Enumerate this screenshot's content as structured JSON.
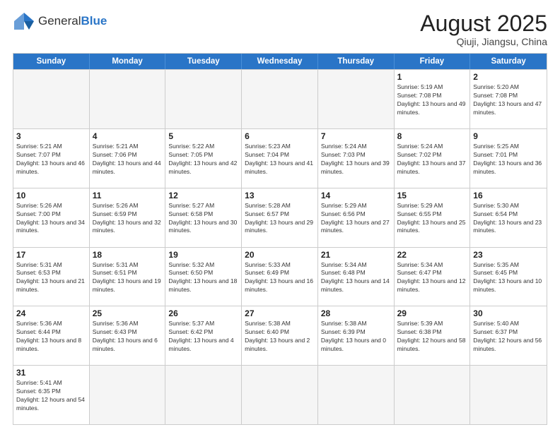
{
  "logo": {
    "text_general": "General",
    "text_blue": "Blue"
  },
  "title": "August 2025",
  "subtitle": "Qiuji, Jiangsu, China",
  "header_days": [
    "Sunday",
    "Monday",
    "Tuesday",
    "Wednesday",
    "Thursday",
    "Friday",
    "Saturday"
  ],
  "weeks": [
    [
      {
        "day": "",
        "empty": true
      },
      {
        "day": "",
        "empty": true
      },
      {
        "day": "",
        "empty": true
      },
      {
        "day": "",
        "empty": true
      },
      {
        "day": "",
        "empty": true
      },
      {
        "day": "1",
        "sunrise": "5:19 AM",
        "sunset": "7:08 PM",
        "daylight": "13 hours and 49 minutes."
      },
      {
        "day": "2",
        "sunrise": "5:20 AM",
        "sunset": "7:08 PM",
        "daylight": "13 hours and 47 minutes."
      }
    ],
    [
      {
        "day": "3",
        "sunrise": "5:21 AM",
        "sunset": "7:07 PM",
        "daylight": "13 hours and 46 minutes."
      },
      {
        "day": "4",
        "sunrise": "5:21 AM",
        "sunset": "7:06 PM",
        "daylight": "13 hours and 44 minutes."
      },
      {
        "day": "5",
        "sunrise": "5:22 AM",
        "sunset": "7:05 PM",
        "daylight": "13 hours and 42 minutes."
      },
      {
        "day": "6",
        "sunrise": "5:23 AM",
        "sunset": "7:04 PM",
        "daylight": "13 hours and 41 minutes."
      },
      {
        "day": "7",
        "sunrise": "5:24 AM",
        "sunset": "7:03 PM",
        "daylight": "13 hours and 39 minutes."
      },
      {
        "day": "8",
        "sunrise": "5:24 AM",
        "sunset": "7:02 PM",
        "daylight": "13 hours and 37 minutes."
      },
      {
        "day": "9",
        "sunrise": "5:25 AM",
        "sunset": "7:01 PM",
        "daylight": "13 hours and 36 minutes."
      }
    ],
    [
      {
        "day": "10",
        "sunrise": "5:26 AM",
        "sunset": "7:00 PM",
        "daylight": "13 hours and 34 minutes."
      },
      {
        "day": "11",
        "sunrise": "5:26 AM",
        "sunset": "6:59 PM",
        "daylight": "13 hours and 32 minutes."
      },
      {
        "day": "12",
        "sunrise": "5:27 AM",
        "sunset": "6:58 PM",
        "daylight": "13 hours and 30 minutes."
      },
      {
        "day": "13",
        "sunrise": "5:28 AM",
        "sunset": "6:57 PM",
        "daylight": "13 hours and 29 minutes."
      },
      {
        "day": "14",
        "sunrise": "5:29 AM",
        "sunset": "6:56 PM",
        "daylight": "13 hours and 27 minutes."
      },
      {
        "day": "15",
        "sunrise": "5:29 AM",
        "sunset": "6:55 PM",
        "daylight": "13 hours and 25 minutes."
      },
      {
        "day": "16",
        "sunrise": "5:30 AM",
        "sunset": "6:54 PM",
        "daylight": "13 hours and 23 minutes."
      }
    ],
    [
      {
        "day": "17",
        "sunrise": "5:31 AM",
        "sunset": "6:53 PM",
        "daylight": "13 hours and 21 minutes."
      },
      {
        "day": "18",
        "sunrise": "5:31 AM",
        "sunset": "6:51 PM",
        "daylight": "13 hours and 19 minutes."
      },
      {
        "day": "19",
        "sunrise": "5:32 AM",
        "sunset": "6:50 PM",
        "daylight": "13 hours and 18 minutes."
      },
      {
        "day": "20",
        "sunrise": "5:33 AM",
        "sunset": "6:49 PM",
        "daylight": "13 hours and 16 minutes."
      },
      {
        "day": "21",
        "sunrise": "5:34 AM",
        "sunset": "6:48 PM",
        "daylight": "13 hours and 14 minutes."
      },
      {
        "day": "22",
        "sunrise": "5:34 AM",
        "sunset": "6:47 PM",
        "daylight": "13 hours and 12 minutes."
      },
      {
        "day": "23",
        "sunrise": "5:35 AM",
        "sunset": "6:45 PM",
        "daylight": "13 hours and 10 minutes."
      }
    ],
    [
      {
        "day": "24",
        "sunrise": "5:36 AM",
        "sunset": "6:44 PM",
        "daylight": "13 hours and 8 minutes."
      },
      {
        "day": "25",
        "sunrise": "5:36 AM",
        "sunset": "6:43 PM",
        "daylight": "13 hours and 6 minutes."
      },
      {
        "day": "26",
        "sunrise": "5:37 AM",
        "sunset": "6:42 PM",
        "daylight": "13 hours and 4 minutes."
      },
      {
        "day": "27",
        "sunrise": "5:38 AM",
        "sunset": "6:40 PM",
        "daylight": "13 hours and 2 minutes."
      },
      {
        "day": "28",
        "sunrise": "5:38 AM",
        "sunset": "6:39 PM",
        "daylight": "13 hours and 0 minutes."
      },
      {
        "day": "29",
        "sunrise": "5:39 AM",
        "sunset": "6:38 PM",
        "daylight": "12 hours and 58 minutes."
      },
      {
        "day": "30",
        "sunrise": "5:40 AM",
        "sunset": "6:37 PM",
        "daylight": "12 hours and 56 minutes."
      }
    ],
    [
      {
        "day": "31",
        "sunrise": "5:41 AM",
        "sunset": "6:35 PM",
        "daylight": "12 hours and 54 minutes."
      },
      {
        "day": "",
        "empty": true
      },
      {
        "day": "",
        "empty": true
      },
      {
        "day": "",
        "empty": true
      },
      {
        "day": "",
        "empty": true
      },
      {
        "day": "",
        "empty": true
      },
      {
        "day": "",
        "empty": true
      }
    ]
  ]
}
